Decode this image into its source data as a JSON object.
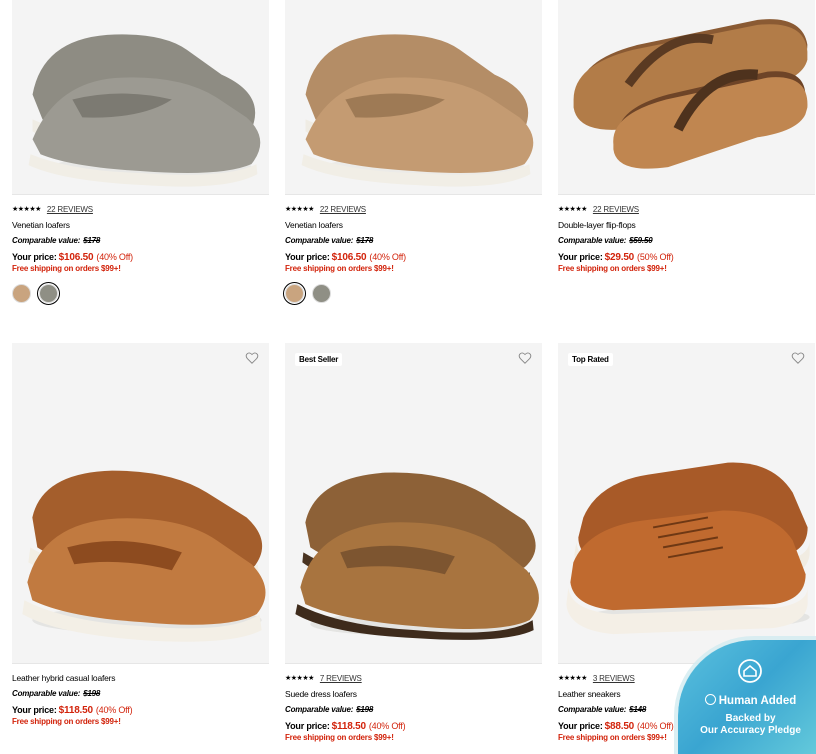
{
  "products": [
    {
      "rating_stars": "★★★★★",
      "reviews": "22 REVIEWS",
      "name": "Venetian loafers",
      "comparable_label": "Comparable value:",
      "comparable_price": "$178",
      "your_price_label": "Your price:",
      "price": "$106.50",
      "discount": "(40% Off)",
      "shipping": "Free shipping on orders $99+!",
      "swatches": [
        "#c9a47f",
        "#8f8f85"
      ],
      "selected_swatch": 1,
      "image": "venetian-loafer-gray",
      "badge": ""
    },
    {
      "rating_stars": "★★★★★",
      "reviews": "22 REVIEWS",
      "name": "Venetian loafers",
      "comparable_label": "Comparable value:",
      "comparable_price": "$178",
      "your_price_label": "Your price:",
      "price": "$106.50",
      "discount": "(40% Off)",
      "shipping": "Free shipping on orders $99+!",
      "swatches": [
        "#c9a47f",
        "#8f8f85"
      ],
      "selected_swatch": 0,
      "image": "venetian-loafer-tan",
      "badge": ""
    },
    {
      "rating_stars": "★★★★★",
      "reviews": "22 REVIEWS",
      "name": "Double-layer flip-flops",
      "comparable_label": "Comparable value:",
      "comparable_price": "$59.50",
      "your_price_label": "Your price:",
      "price": "$29.50",
      "discount": "(50% Off)",
      "shipping": "Free shipping on orders $99+!",
      "swatches": [],
      "image": "flip-flop-brown",
      "badge": ""
    },
    {
      "rating_stars": "",
      "reviews": "",
      "name": "Leather hybrid casual loafers",
      "comparable_label": "Comparable value:",
      "comparable_price": "$198",
      "your_price_label": "Your price:",
      "price": "$118.50",
      "discount": "(40% Off)",
      "shipping": "Free shipping on orders $99+!",
      "swatches": [],
      "image": "leather-penny-loafer",
      "badge": ""
    },
    {
      "rating_stars": "★★★★★",
      "reviews": "7 REVIEWS",
      "name": "Suede dress loafers",
      "comparable_label": "Comparable value:",
      "comparable_price": "$198",
      "your_price_label": "Your price:",
      "price": "$118.50",
      "discount": "(40% Off)",
      "shipping": "Free shipping on orders $99+!",
      "swatches": [],
      "image": "suede-penny-loafer",
      "badge": "Best Seller"
    },
    {
      "rating_stars": "★★★★★",
      "reviews": "3 REVIEWS",
      "name": "Leather sneakers",
      "comparable_label": "Comparable value:",
      "comparable_price": "$148",
      "your_price_label": "Your price:",
      "price": "$88.50",
      "discount": "(40% Off)",
      "shipping": "Free shipping on orders $99+!",
      "swatches": [],
      "image": "leather-sneaker",
      "badge": "Top Rated"
    }
  ],
  "pledge": {
    "title": "Human Added",
    "line1": "Backed by",
    "line2": "Our Accuracy Pledge"
  },
  "colors": {
    "sale_red": "#d2230b",
    "pledge_blue": "#3aa5d1"
  }
}
